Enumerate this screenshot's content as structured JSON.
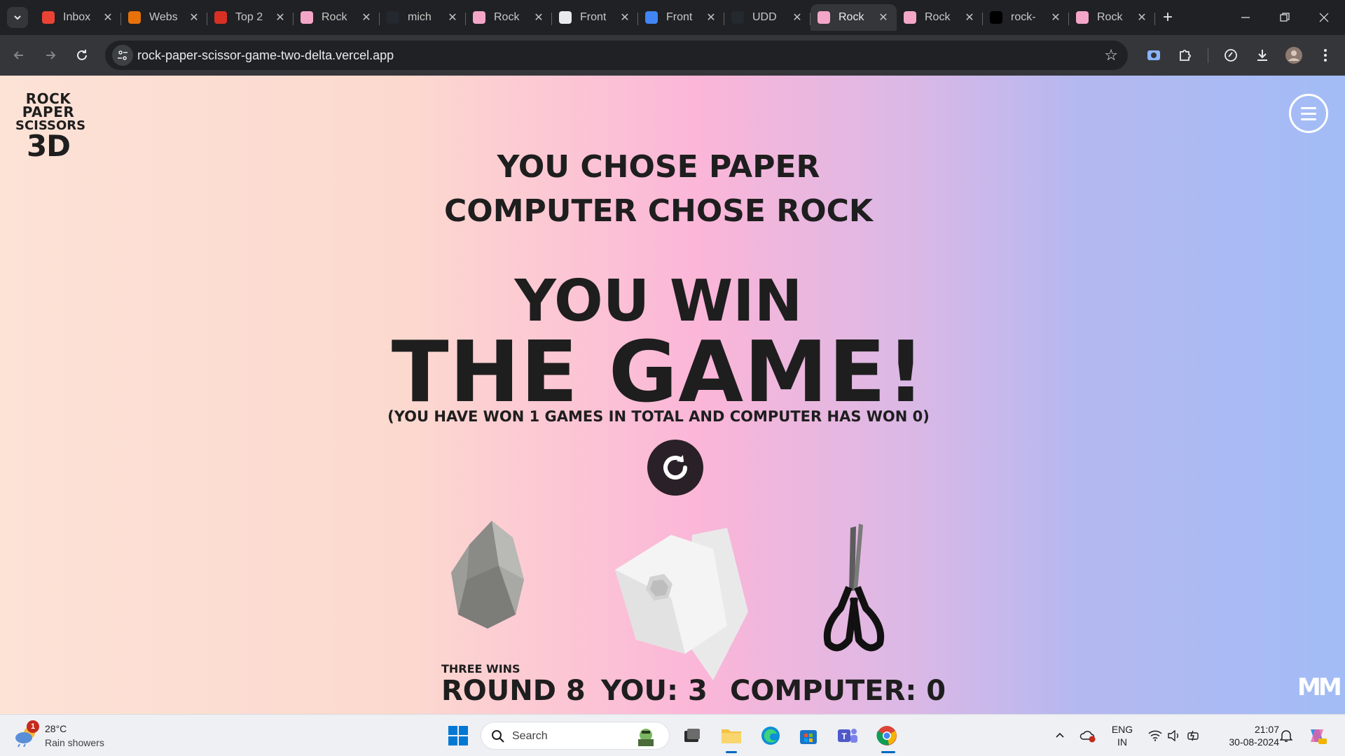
{
  "browser": {
    "tabs": [
      {
        "label": "Inbox",
        "favicon": "gmail",
        "color": "#ea4335",
        "active": false
      },
      {
        "label": "Webs",
        "favicon": "grid",
        "color": "#e8710a",
        "active": false
      },
      {
        "label": "Top 2",
        "favicon": "shield",
        "color": "#d93025",
        "active": false
      },
      {
        "label": "Rock",
        "favicon": "rock",
        "color": "#f4a6c8",
        "active": false
      },
      {
        "label": "mich",
        "favicon": "github",
        "color": "#24292f",
        "active": false
      },
      {
        "label": "Rock",
        "favicon": "rock",
        "color": "#f4a6c8",
        "active": false
      },
      {
        "label": "Front",
        "favicon": "frontend",
        "color": "#e8eaed",
        "active": false
      },
      {
        "label": "Front",
        "favicon": "pen",
        "color": "#4285f4",
        "active": false
      },
      {
        "label": "UDD",
        "favicon": "github",
        "color": "#24292f",
        "active": false
      },
      {
        "label": "Rock",
        "favicon": "rock",
        "color": "#f4a6c8",
        "active": true
      },
      {
        "label": "Rock",
        "favicon": "rock",
        "color": "#f4a6c8",
        "active": false
      },
      {
        "label": "rock-",
        "favicon": "vercel",
        "color": "#000000",
        "active": false
      },
      {
        "label": "Rock",
        "favicon": "rock",
        "color": "#f4a6c8",
        "active": false
      }
    ],
    "url": "rock-paper-scissor-game-two-delta.vercel.app"
  },
  "game": {
    "logo": {
      "line1": "ROCK",
      "line2": "PAPER",
      "line3": "SCISSORS",
      "line4": "3D"
    },
    "you_chose": "YOU CHOSE PAPER",
    "computer_chose": "COMPUTER CHOSE ROCK",
    "result_line1": "YOU WIN",
    "result_line2": "THE GAME!",
    "total_line": "(YOU HAVE WON 1 GAMES IN TOTAL AND COMPUTER HAS WON 0)",
    "hands": [
      "rock",
      "paper",
      "scissors"
    ],
    "mode": "THREE WINS",
    "round": "ROUND 8",
    "you_score": "YOU: 3",
    "computer_score": "COMPUTER: 0",
    "brand": "MM"
  },
  "taskbar": {
    "weather_temp": "28°C",
    "weather_cond": "Rain showers",
    "weather_badge": "1",
    "search_placeholder": "Search",
    "lang_line1": "ENG",
    "lang_line2": "IN",
    "time": "21:07",
    "date": "30-08-2024"
  }
}
